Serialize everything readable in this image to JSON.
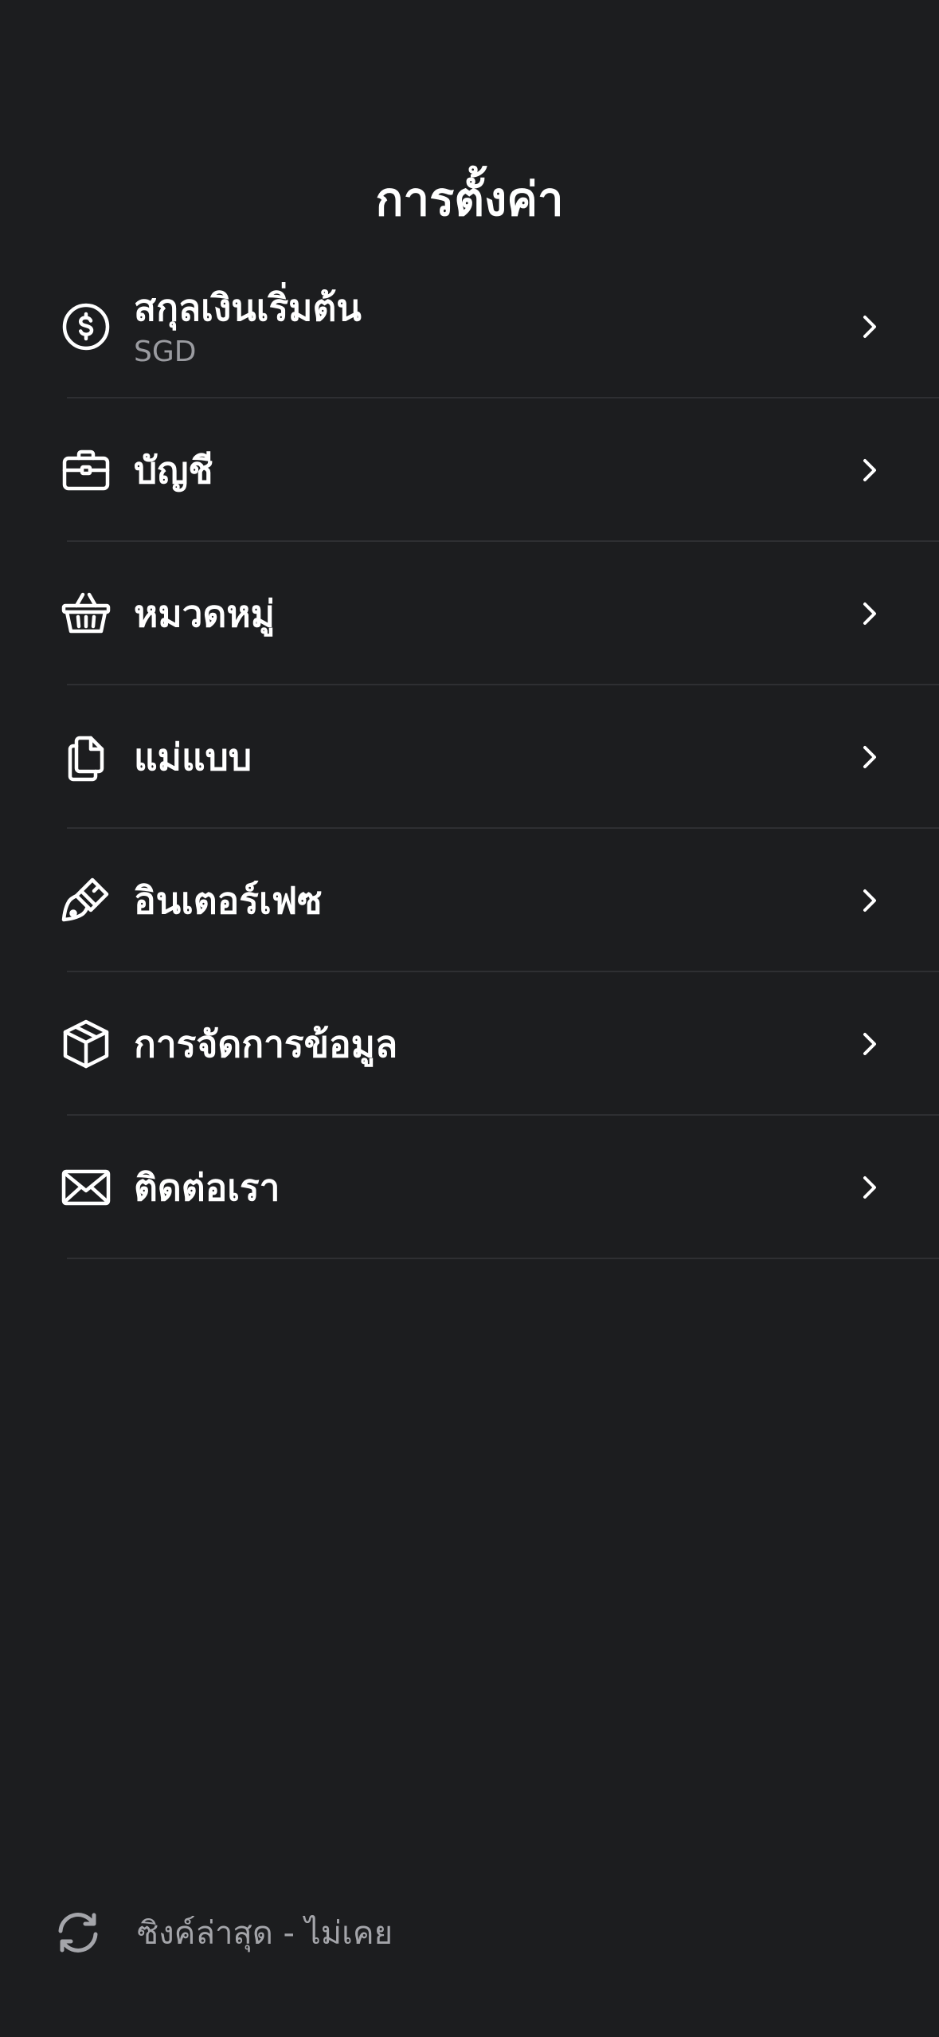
{
  "header": {
    "title": "การตั้งค่า"
  },
  "settings": {
    "items": [
      {
        "label": "สกุลเงินเริ่มต้น",
        "value": "SGD",
        "icon": "dollar-circle-icon"
      },
      {
        "label": "บัญชี",
        "icon": "briefcase-icon"
      },
      {
        "label": "หมวดหมู่",
        "icon": "basket-icon"
      },
      {
        "label": "แม่แบบ",
        "icon": "documents-icon"
      },
      {
        "label": "อินเตอร์เฟซ",
        "icon": "paintbrush-icon"
      },
      {
        "label": "การจัดการข้อมูล",
        "icon": "box-icon"
      },
      {
        "label": "ติดต่อเรา",
        "icon": "mail-icon"
      }
    ]
  },
  "footer": {
    "sync_text": "ซิงค์ล่าสุด - ไม่เคย",
    "icon": "sync-icon"
  },
  "colors": {
    "background": "#1c1d1f",
    "text": "#ffffff",
    "secondary_text": "#9a9ba0",
    "divider": "#2e2f32"
  }
}
